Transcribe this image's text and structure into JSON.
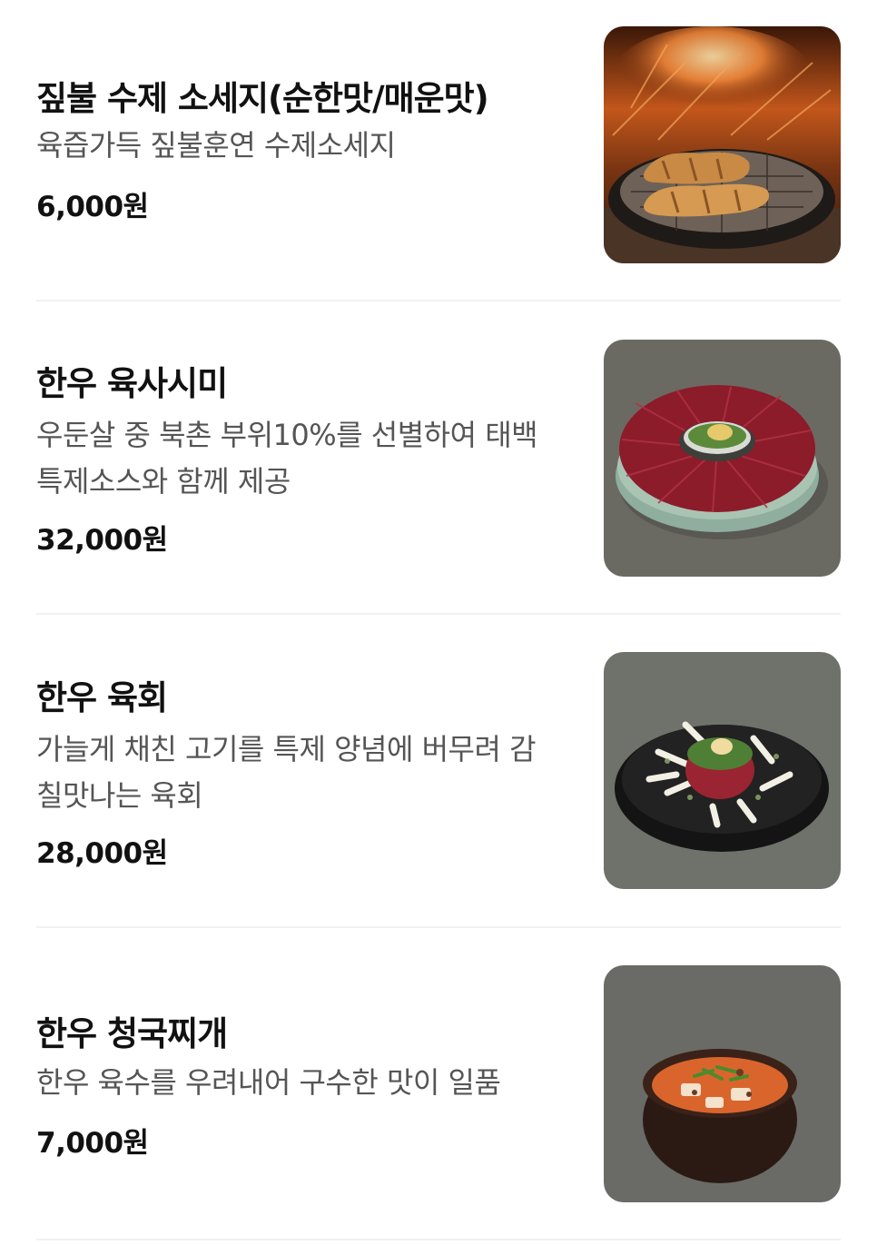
{
  "menu": {
    "items": [
      {
        "name": "짚불 수제 소세지(순한맛/매운맛)",
        "description": "육즙가득 짚불훈연 수제소세지",
        "price": "6,000원",
        "image": "sausage-photo"
      },
      {
        "name": "한우 육사시미",
        "description": "우둔살 중 북촌 부위10%를 선별하여 태백 특제소스와 함께 제공",
        "price": "32,000원",
        "image": "yuk-sashimi-photo"
      },
      {
        "name": "한우 육회",
        "description": "가늘게 채친 고기를 특제 양념에 버무려 감칠맛나는 육회",
        "price": "28,000원",
        "image": "yukhoe-photo"
      },
      {
        "name": "한우 청국찌개",
        "description": "한우 육수를 우려내어 구수한 맛이 일품",
        "price": "7,000원",
        "image": "cheonggukjang-stew-photo"
      }
    ]
  }
}
